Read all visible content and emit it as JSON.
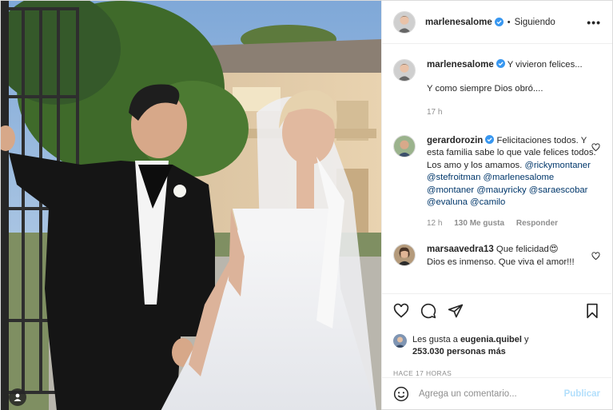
{
  "post": {
    "author": "marlenesalome",
    "follow_status": "Siguiendo",
    "more_glyph": "•••"
  },
  "comments": [
    {
      "user": "marlenesalome",
      "verified": true,
      "line1": "Y vivieron felices...",
      "line2": "Y como siempre Dios obró....",
      "time": "17 h"
    },
    {
      "user": "gerardorozin",
      "verified": true,
      "text": "Felicitaciones todos. Y esta familia sabe lo que vale felices todos. Los amo y los amamos.",
      "mentions": "@rickymontaner @stefroitman @marlenesalome @montaner @mauyricky @saraescobar @evaluna @camilo",
      "time": "12 h",
      "likes": "130 Me gusta",
      "reply": "Responder"
    },
    {
      "user": "marsaavedra13",
      "verified": false,
      "text": "Que felicidad",
      "emoji": "😍",
      "line2": "Dios es inmenso. Que viva el amor!!!"
    }
  ],
  "likes": {
    "prefix": "Les gusta a",
    "user": "eugenia.quibel",
    "conj": "y",
    "count": "253.030 personas más"
  },
  "timestamp": "HACE 17 HORAS",
  "add_comment": {
    "placeholder": "Agrega un comentario...",
    "publish": "Publicar"
  },
  "colors": {
    "verified": "#3897f0",
    "mention": "#00376b",
    "publish": "#b2dffc",
    "meta": "#8e8e8e"
  },
  "icons": [
    "heart-icon",
    "comment-icon",
    "share-icon",
    "bookmark-icon",
    "emoji-icon",
    "user-tag-icon",
    "verified-badge-icon"
  ]
}
